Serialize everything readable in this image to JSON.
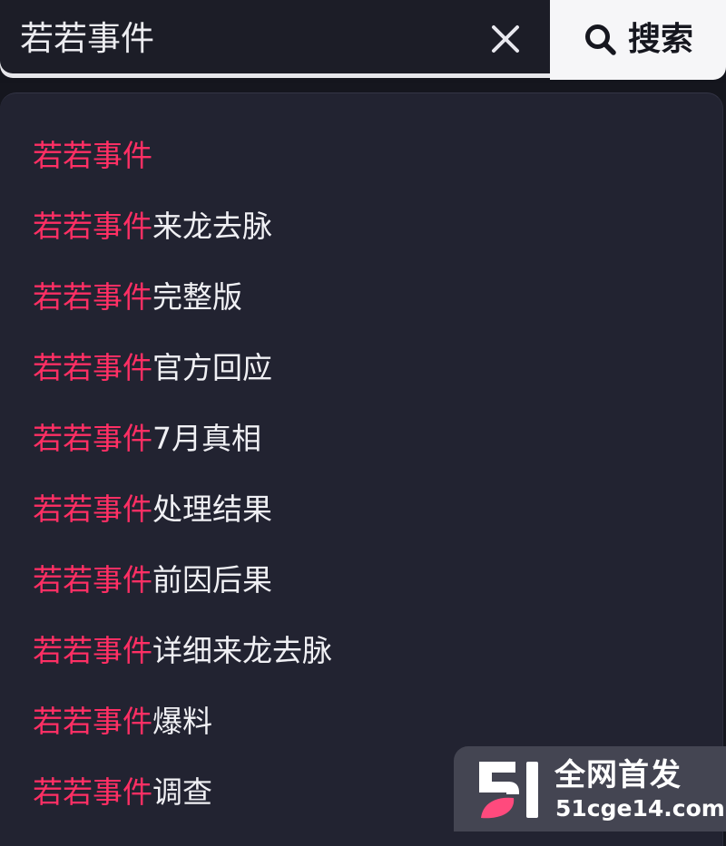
{
  "search": {
    "value": "若若事件",
    "clear_icon": "close-icon",
    "button_icon": "search-icon",
    "button_label": "搜索"
  },
  "suggestions": {
    "keyword": "若若事件",
    "items": [
      {
        "highlight": "若若事件",
        "rest": ""
      },
      {
        "highlight": "若若事件",
        "rest": "来龙去脉"
      },
      {
        "highlight": "若若事件",
        "rest": "完整版"
      },
      {
        "highlight": "若若事件",
        "rest": "官方回应"
      },
      {
        "highlight": "若若事件",
        "rest": "7月真相"
      },
      {
        "highlight": "若若事件",
        "rest": "处理结果"
      },
      {
        "highlight": "若若事件",
        "rest": "前因后果"
      },
      {
        "highlight": "若若事件",
        "rest": "详细来龙去脉"
      },
      {
        "highlight": "若若事件",
        "rest": "爆料"
      },
      {
        "highlight": "若若事件",
        "rest": "调查"
      }
    ]
  },
  "watermark": {
    "title": "全网首发",
    "url": "51cge14.com",
    "logo_icon": "51-logo-icon"
  },
  "colors": {
    "highlight": "#ff2f64",
    "dropdown_bg": "#222331",
    "search_button_bg": "#f6f6f8"
  }
}
